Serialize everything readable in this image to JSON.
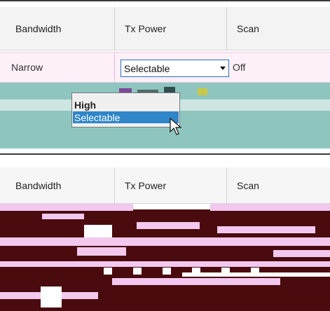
{
  "columns": [
    "Bandwidth",
    "Tx Power",
    "Scan"
  ],
  "row": {
    "bandwidth": "Narrow",
    "tx_power": "Selectable",
    "scan": "Off"
  },
  "dropdown": {
    "options": [
      "High",
      "Selectable"
    ],
    "highlighted": "Selectable"
  },
  "bottom_columns": [
    "Bandwidth",
    "Tx Power",
    "Scan"
  ],
  "colors": {
    "selection": "#2f86c8",
    "row_bg": "#fdf0f8",
    "teal": "#8ec6bf",
    "header_bg": "#f3f3f3"
  }
}
